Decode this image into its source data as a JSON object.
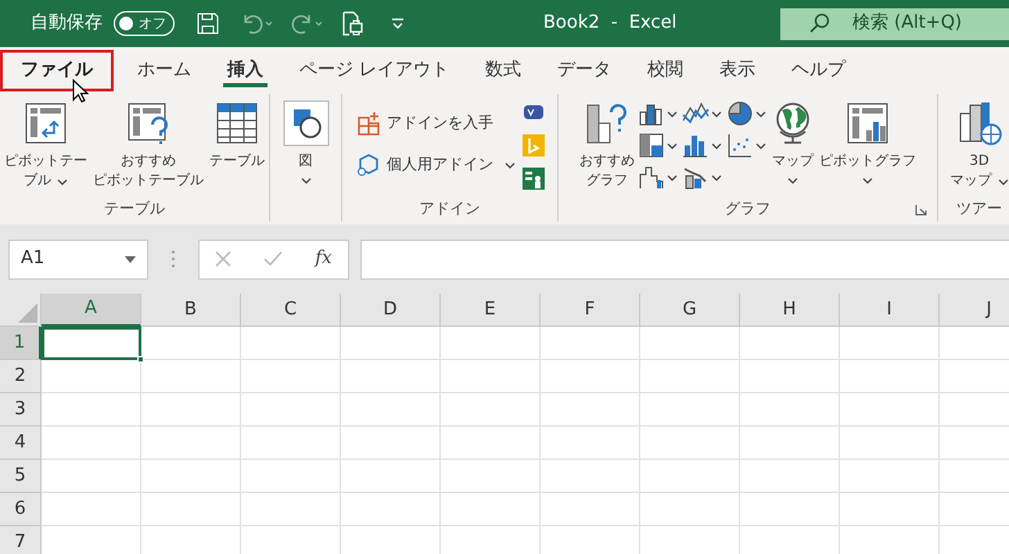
{
  "title_bar": {
    "autosave_label": "自動保存",
    "autosave_toggle": {
      "label": "オフ",
      "on": false
    },
    "title": "Book2  -  Excel",
    "search": {
      "placeholder": "検索 (Alt+Q)"
    }
  },
  "tabs": [
    {
      "label": "ファイル",
      "selected": false,
      "highlighted": true
    },
    {
      "label": "ホーム",
      "selected": false,
      "highlighted": false
    },
    {
      "label": "挿入",
      "selected": true,
      "highlighted": false
    },
    {
      "label": "ページ レイアウト",
      "selected": false,
      "highlighted": false
    },
    {
      "label": "数式",
      "selected": false,
      "highlighted": false
    },
    {
      "label": "データ",
      "selected": false,
      "highlighted": false
    },
    {
      "label": "校閲",
      "selected": false,
      "highlighted": false
    },
    {
      "label": "表示",
      "selected": false,
      "highlighted": false
    },
    {
      "label": "ヘルプ",
      "selected": false,
      "highlighted": false
    }
  ],
  "ribbon": {
    "groups": [
      {
        "label": "テーブル",
        "items": [
          {
            "kind": "large",
            "lines": [
              "ピボットテー",
              "ブル"
            ],
            "dropdown": true
          },
          {
            "kind": "large",
            "lines": [
              "おすすめ",
              "ピボットテーブル"
            ],
            "dropdown": false
          },
          {
            "kind": "large",
            "lines": [
              "テーブル"
            ],
            "dropdown": false
          }
        ]
      },
      {
        "items": [
          {
            "kind": "large",
            "lines": [
              "図"
            ],
            "dropdown": true
          }
        ]
      },
      {
        "label": "アドイン",
        "items": [
          {
            "kind": "small",
            "label": "アドインを入手",
            "dropdown": false
          },
          {
            "kind": "small",
            "label": "個人用アドイン",
            "dropdown": true
          },
          {
            "kind": "apps"
          }
        ]
      },
      {
        "label": "グラフ",
        "launcher": true,
        "items": [
          {
            "kind": "large",
            "lines": [
              "おすすめ",
              "グラフ"
            ],
            "dropdown": false
          },
          {
            "kind": "charts"
          },
          {
            "kind": "large",
            "lines": [
              "マップ"
            ],
            "dropdown": true
          },
          {
            "kind": "large",
            "lines": [
              "ピボットグラフ"
            ],
            "dropdown": true
          }
        ]
      },
      {
        "label": "ツアー",
        "items": [
          {
            "kind": "large",
            "lines": [
              "3D",
              "マップ"
            ],
            "dropdown": true
          }
        ]
      }
    ]
  },
  "formula_bar": {
    "name_box": "A1",
    "function_label": "fx"
  },
  "sheet": {
    "columns": [
      {
        "label": "A",
        "selected": true
      },
      {
        "label": "B",
        "selected": false
      },
      {
        "label": "C",
        "selected": false
      },
      {
        "label": "D",
        "selected": false
      },
      {
        "label": "E",
        "selected": false
      },
      {
        "label": "F",
        "selected": false
      },
      {
        "label": "G",
        "selected": false
      },
      {
        "label": "H",
        "selected": false
      },
      {
        "label": "I",
        "selected": false
      },
      {
        "label": "J",
        "selected": false
      }
    ],
    "rows": [
      {
        "label": "1",
        "selected": true
      },
      {
        "label": "2",
        "selected": false
      },
      {
        "label": "3",
        "selected": false
      },
      {
        "label": "4",
        "selected": false
      },
      {
        "label": "5",
        "selected": false
      },
      {
        "label": "6",
        "selected": false
      },
      {
        "label": "7",
        "selected": false
      }
    ]
  }
}
